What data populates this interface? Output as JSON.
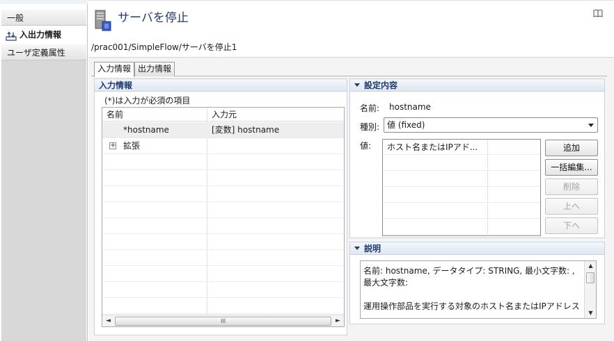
{
  "nav": {
    "items": [
      {
        "label": "一般",
        "icon": "none"
      },
      {
        "label": "入出力情報",
        "icon": "io-icon"
      },
      {
        "label": "ユーザ定義属性",
        "icon": "none"
      }
    ]
  },
  "header": {
    "title": "サーバを停止",
    "path": "/prac001/SimpleFlow/サーバを停止1",
    "icons": {
      "title": "server-icon",
      "help": "book-icon"
    }
  },
  "tabs": [
    "入力情報",
    "出力情報"
  ],
  "input_pane": {
    "title": "入力情報",
    "note": "(*)は入力が必須の項目",
    "columns": [
      "名前",
      "入力元"
    ],
    "rows": [
      {
        "name": "*hostname",
        "source": "[変数] hostname"
      },
      {
        "name": "拡張",
        "source": ""
      }
    ],
    "scroll_glyph": "III"
  },
  "settings_pane": {
    "title": "設定内容",
    "name_label": "名前:",
    "name_value": "hostname",
    "kind_label": "種別:",
    "kind_value": "値 (fixed)",
    "value_label": "値:",
    "value_column": "ホスト名またはIPアド...",
    "buttons": {
      "add": "追加",
      "bulk_edit": "一括編集...",
      "delete": "削除",
      "up": "上へ",
      "down": "下へ"
    }
  },
  "description_pane": {
    "title": "説明",
    "text": "名前: hostname, データタイプ: STRING, 最小文字数: , 最大文字数:\n\n運用操作部品を実行する対象のホスト名またはIPアドレス"
  },
  "colors": {
    "accent": "#1f3a6e",
    "pane_header": "#dfe7f1",
    "selected_row": "#eeeeee"
  }
}
